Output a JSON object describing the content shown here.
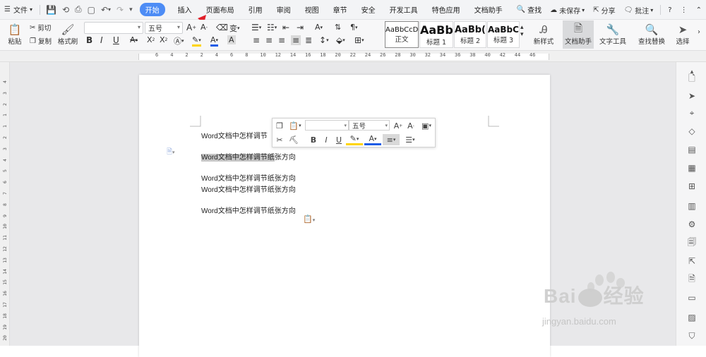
{
  "menubar": {
    "file_label": "文件",
    "tabs": [
      {
        "label": "开始",
        "active": true
      },
      {
        "label": "插入"
      },
      {
        "label": "页面布局"
      },
      {
        "label": "引用"
      },
      {
        "label": "审阅"
      },
      {
        "label": "视图"
      },
      {
        "label": "章节"
      },
      {
        "label": "安全"
      },
      {
        "label": "开发工具"
      },
      {
        "label": "特色应用"
      },
      {
        "label": "文档助手"
      }
    ],
    "search_label": "查找",
    "unsaved_label": "未保存",
    "share_label": "分享",
    "comment_label": "批注",
    "help_glyph": "?",
    "accent_color": "#4d8cf5"
  },
  "ribbon": {
    "paste_label": "粘贴",
    "cut_label": "剪切",
    "copy_label": "复制",
    "format_painter_label": "格式刷",
    "font_name_value": "",
    "font_size_value": "五号",
    "bold": "B",
    "italic": "I",
    "underline": "U",
    "styles": [
      {
        "sample": "AaBbCcDd",
        "name": "正文"
      },
      {
        "sample": "AaBb",
        "name": "标题 1"
      },
      {
        "sample": "AaBb(",
        "name": "标题 2"
      },
      {
        "sample": "AaBbC(",
        "name": "标题 3"
      }
    ],
    "new_style_label": "新样式",
    "doc_assistant_label": "文档助手",
    "text_tools_label": "文字工具",
    "find_replace_label": "查找替换",
    "select_label": "选择"
  },
  "ruler": {
    "ticks": [
      "6",
      "4",
      "2",
      "2",
      "4",
      "6",
      "8",
      "10",
      "12",
      "14",
      "16",
      "18",
      "20",
      "22",
      "24",
      "26",
      "28",
      "30",
      "32",
      "34",
      "36",
      "38",
      "40",
      "42",
      "44",
      "46"
    ],
    "vticks": [
      "4",
      "3",
      "2",
      "1",
      "1",
      "2",
      "3",
      "4",
      "5",
      "6",
      "7",
      "8",
      "9",
      "10",
      "11",
      "12",
      "13",
      "14",
      "15",
      "16",
      "17",
      "18",
      "19",
      "20"
    ]
  },
  "document": {
    "lines": [
      {
        "text": "Word文档中怎样调节",
        "suffix": ""
      },
      {
        "text": "Word文档中怎样调节纸",
        "suffix": "张方向",
        "highlight": true
      },
      {
        "text": "Word文档中怎样调节纸张方向"
      },
      {
        "text": "Word文档中怎样调节纸张方向"
      },
      {
        "text": "Word文档中怎样调节纸张方向"
      }
    ]
  },
  "minitoolbar": {
    "font_name_value": "",
    "font_size_value": "五号",
    "bold": "B",
    "italic": "I",
    "underline": "U"
  },
  "watermark": {
    "brand": "Bai",
    "brand_cn": "经验",
    "url": "jingyan.baidu.com"
  }
}
